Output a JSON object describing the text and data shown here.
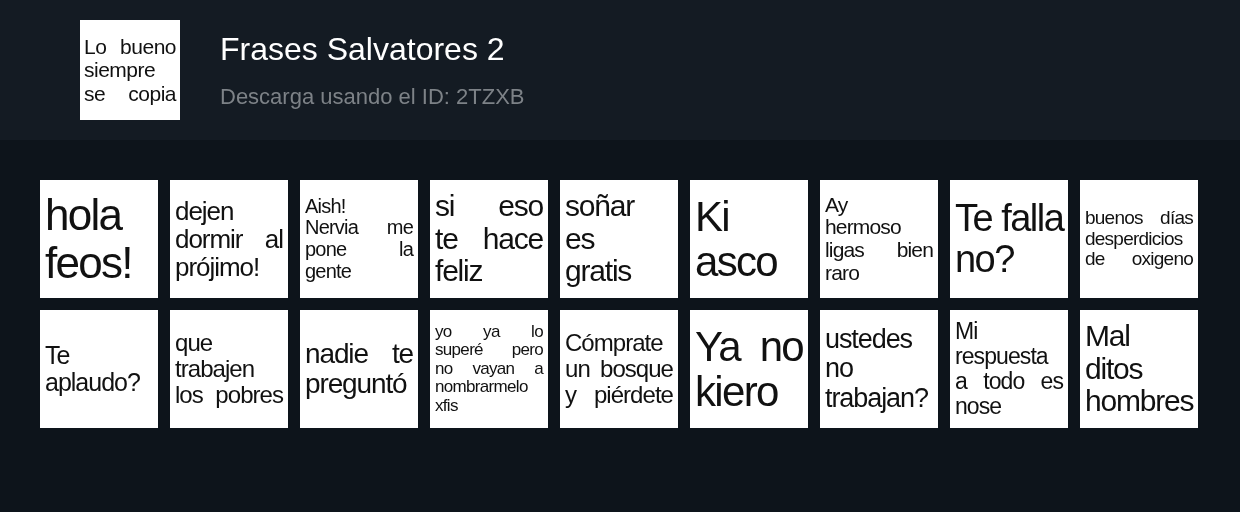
{
  "pack": {
    "tray_sticker": [
      "Lo bueno",
      "siempre",
      "se copia"
    ],
    "title": "Frases Salvatores 2",
    "subtitle": "Descarga usando el ID: 2TZXB"
  },
  "stickers": [
    {
      "lines": [
        "hola",
        "feos!"
      ]
    },
    {
      "lines": [
        "dejen",
        "dormir al",
        "prójimo!"
      ]
    },
    {
      "lines": [
        "Aish!",
        "Nervia me",
        "pone la",
        "gente"
      ]
    },
    {
      "lines": [
        "si eso",
        "te hace",
        "feliz"
      ]
    },
    {
      "lines": [
        "soñar",
        "es",
        "gratis"
      ]
    },
    {
      "lines": [
        "Ki",
        "asco"
      ]
    },
    {
      "lines": [
        "Ay",
        "hermoso",
        "ligas bien",
        "raro"
      ]
    },
    {
      "lines": [
        "Te falla",
        "no?"
      ]
    },
    {
      "lines": [
        "buenos días",
        "desperdicios",
        "de oxigeno"
      ]
    },
    {
      "lines": [
        "Te",
        "aplaudo?"
      ]
    },
    {
      "lines": [
        "que",
        "trabajen",
        "los pobres"
      ]
    },
    {
      "lines": [
        "nadie te",
        "preguntó"
      ]
    },
    {
      "lines": [
        "yo ya lo",
        "superé pero",
        "no vayan a",
        "nombrarmelo",
        "xfis"
      ]
    },
    {
      "lines": [
        "Cómprate",
        "un bosque",
        "y piérdete"
      ]
    },
    {
      "lines": [
        "Ya no",
        "kiero"
      ]
    },
    {
      "lines": [
        "ustedes",
        "no",
        "trabajan?"
      ]
    },
    {
      "lines": [
        "Mi",
        "respuesta",
        "a todo es",
        "nose"
      ]
    },
    {
      "lines": [
        "Mal",
        "ditos",
        "hombres"
      ]
    }
  ]
}
